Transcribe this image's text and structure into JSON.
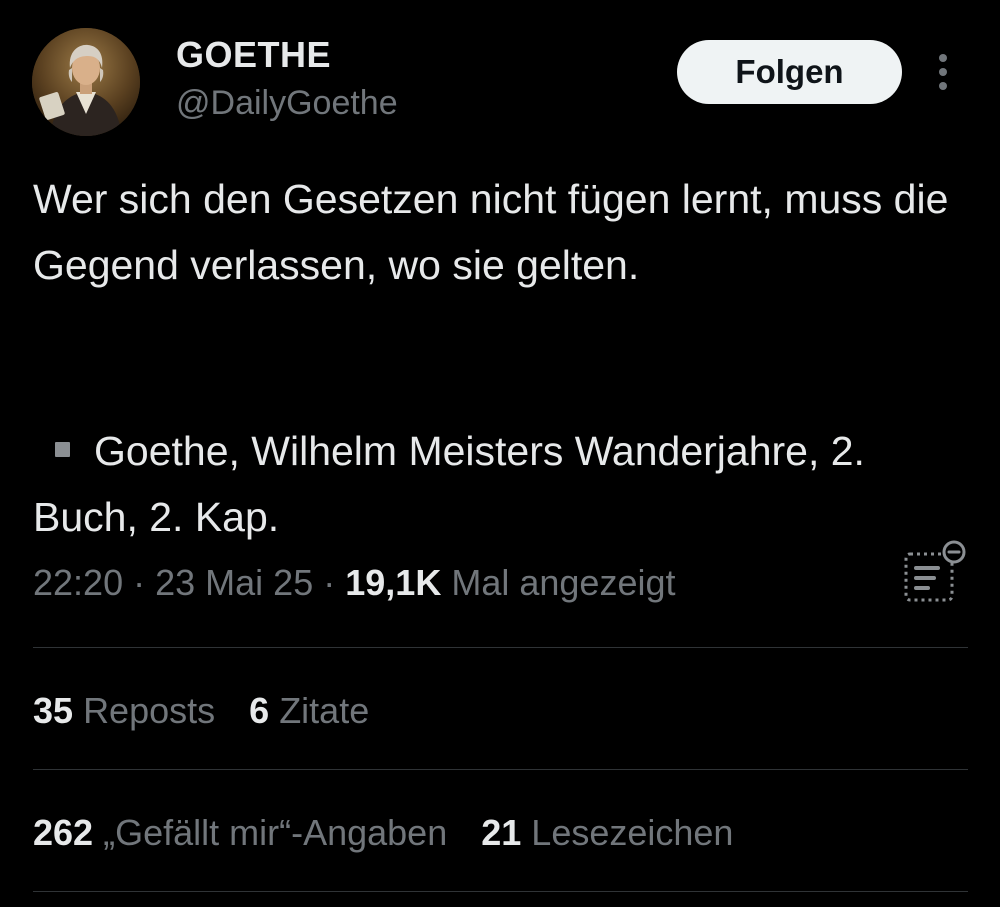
{
  "author": {
    "display_name": "GOETHE",
    "handle": "@DailyGoethe",
    "avatar_icon": "portrait-avatar"
  },
  "actions": {
    "follow_label": "Folgen",
    "more_icon": "vertical-ellipsis-icon"
  },
  "tweet": {
    "text": "Wer sich den Gesetzen nicht fügen lernt, muss die Gegend verlassen, wo sie gelten.",
    "source_glyph": "▪",
    "source": "Goethe, Wilhelm Meisters Wanderjahre, 2. Buch, 2. Kap."
  },
  "meta": {
    "time": "22:20",
    "separator": "·",
    "date": "23 Mai 25",
    "views_count": "19,1K",
    "views_label": "Mal angezeigt",
    "analytics_icon": "post-analytics-icon"
  },
  "stats": {
    "reposts_count": "35",
    "reposts_label": "Reposts",
    "quotes_count": "6",
    "quotes_label": "Zitate",
    "likes_count": "262",
    "likes_label": "„Gefällt mir“-Angaben",
    "bookmarks_count": "21",
    "bookmarks_label": "Lesezeichen"
  },
  "colors": {
    "background": "#000000",
    "primary_text": "#e7e9ea",
    "secondary_text": "#71767b",
    "divider": "#2f3336",
    "follow_bg": "#eff3f4",
    "follow_text": "#0f1419"
  }
}
